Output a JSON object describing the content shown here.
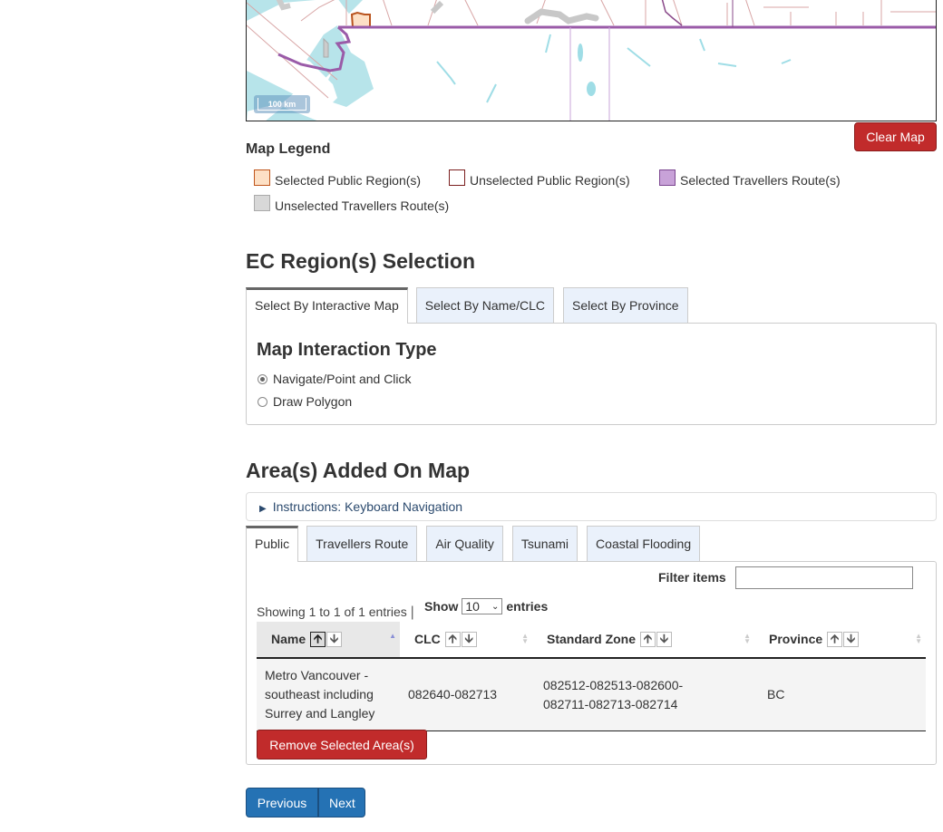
{
  "map": {
    "scale_label": "100 km",
    "clear_button": "Clear Map"
  },
  "legend": {
    "title": "Map Legend",
    "items": [
      {
        "label": "Selected Public Region(s)",
        "color": "#fde0c5",
        "border": "#c0551b"
      },
      {
        "label": "Unselected Public Region(s)",
        "color": "#ffffff",
        "border": "#7b1e1e"
      },
      {
        "label": "Selected Travellers Route(s)",
        "color": "#c8a2d8",
        "border": "#7c4790"
      },
      {
        "label": "Unselected Travellers Route(s)",
        "color": "#d8d8d8",
        "border": "#aaaaaa"
      }
    ]
  },
  "ec_selection": {
    "heading": "EC Region(s) Selection",
    "tabs": [
      {
        "label": "Select By Interactive Map",
        "active": true
      },
      {
        "label": "Select By Name/CLC",
        "active": false
      },
      {
        "label": "Select By Province",
        "active": false
      }
    ],
    "interaction": {
      "heading": "Map Interaction Type",
      "options": [
        {
          "label": "Navigate/Point and Click",
          "checked": true
        },
        {
          "label": "Draw Polygon",
          "checked": false
        }
      ]
    }
  },
  "areas": {
    "heading": "Area(s) Added On Map",
    "instructions": "Instructions: Keyboard Navigation",
    "tabs": [
      {
        "label": "Public",
        "active": true
      },
      {
        "label": "Travellers Route",
        "active": false
      },
      {
        "label": "Air Quality",
        "active": false
      },
      {
        "label": "Tsunami",
        "active": false
      },
      {
        "label": "Coastal Flooding",
        "active": false
      }
    ],
    "filter_label": "Filter items",
    "filter_value": "",
    "showing": "Showing 1 to 1 of 1 entries",
    "show_label": "Show",
    "page_size": "10",
    "entries_label": "entries",
    "columns": [
      "Name",
      "CLC",
      "Standard Zone",
      "Province"
    ],
    "rows": [
      {
        "name": "Metro Vancouver - southeast including Surrey and Langley",
        "clc": "082640-082713",
        "zone": "082512-082513-082600-082711-082713-082714",
        "province": "BC"
      }
    ],
    "remove_button": "Remove Selected Area(s)"
  },
  "pager": {
    "previous": "Previous",
    "next": "Next"
  },
  "colors": {
    "danger": "#c12b2b",
    "primary": "#2572b4",
    "tab_bg": "#eaf1fb"
  }
}
